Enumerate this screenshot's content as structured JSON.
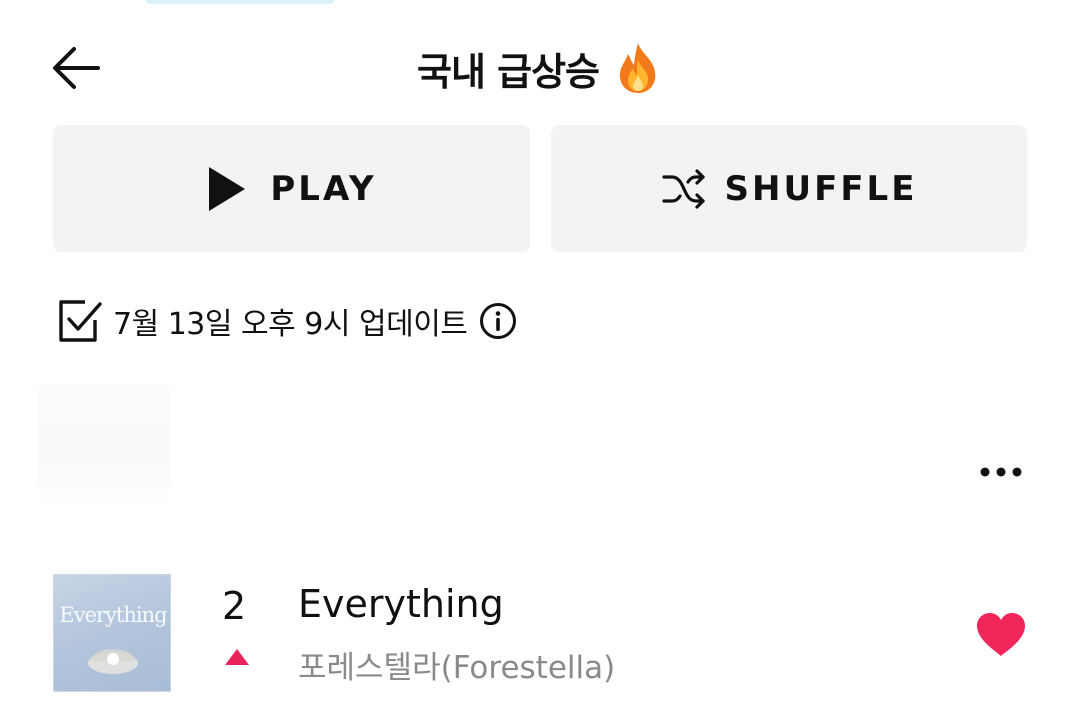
{
  "header": {
    "title": "국내 급상승",
    "title_icon": "fire-emoji",
    "back_icon": "arrow-left-icon"
  },
  "actions": {
    "play_label": "PLAY",
    "shuffle_label": "SHUFFLE"
  },
  "update": {
    "text": "7월 13일 오후 9시 업데이트",
    "icon": "checkbox-icon",
    "info_icon": "info-icon"
  },
  "more_icon": "more-horizontal-icon",
  "tracks": [
    {
      "rank": "2",
      "rank_change": "up",
      "title": "Everything",
      "artist": "포레스텔라(Forestella)",
      "album_art_text": "Everything",
      "liked": true
    }
  ],
  "colors": {
    "heart": "#f0265a",
    "rank_up": "#e8245b",
    "artist_text": "#8a8a8a",
    "button_bg": "#f3f3f3"
  }
}
